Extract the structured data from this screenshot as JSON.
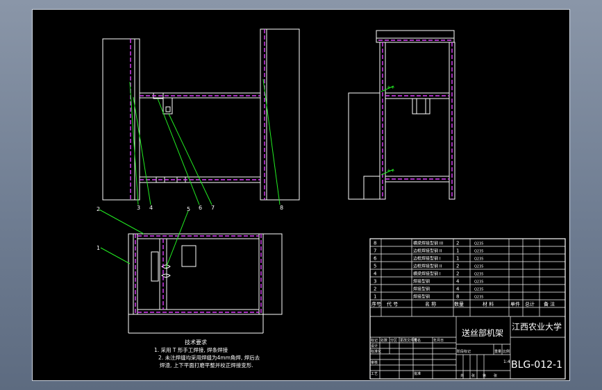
{
  "bom": {
    "rows": [
      {
        "no": "8",
        "name": "横梁焊接型钢 III",
        "qty": "2",
        "material": "Q235"
      },
      {
        "no": "7",
        "name": "边框焊接型钢 II",
        "qty": "1",
        "material": "Q235"
      },
      {
        "no": "6",
        "name": "边框焊接型钢 I",
        "qty": "1",
        "material": "Q235"
      },
      {
        "no": "5",
        "name": "边框焊接型钢 II",
        "qty": "2",
        "material": "Q235"
      },
      {
        "no": "4",
        "name": "横梁焊接型钢 I",
        "qty": "2",
        "material": "Q235"
      },
      {
        "no": "3",
        "name": "焊接型钢",
        "qty": "4",
        "material": "Q235"
      },
      {
        "no": "2",
        "name": "焊接型钢",
        "qty": "4",
        "material": "Q235"
      },
      {
        "no": "1",
        "name": "焊接型钢",
        "qty": "8",
        "material": "Q235"
      }
    ],
    "headers": {
      "seq": "序号",
      "code": "代 号",
      "name": "名 称",
      "qty": "数量",
      "material": "材 料",
      "single": "单件",
      "total": "总计",
      "remark": "备 注"
    }
  },
  "title_block": {
    "drawing_title": "送丝部机架",
    "university": "江西农业大学",
    "drawing_no": "BLG-012-1",
    "labels": [
      "标记",
      "处数",
      "分区",
      "更改文件号",
      "签名",
      "年月日",
      "设计",
      "标准化",
      "审核",
      "工艺",
      "批准",
      "阶段标记",
      "重量",
      "比例"
    ],
    "scale": "1:4",
    "sheet_labels": [
      "共",
      "张",
      "第",
      "张"
    ]
  },
  "tech_notes": {
    "title": "技术要求",
    "lines": [
      "1. 采用 T 形手工焊接, 焊条焊接",
      "2. 未注焊缝均采用焊缝为4mm角焊, 焊后去",
      "焊渣, 上下平面打磨平整并校正焊接变形."
    ]
  },
  "callouts": [
    "1",
    "2",
    "3",
    "4",
    "5",
    "6",
    "7",
    "8"
  ],
  "colors": {
    "outline": "#ffffff",
    "hidden": "#e040ff",
    "leader": "#22ee22",
    "paper": "#000000"
  }
}
